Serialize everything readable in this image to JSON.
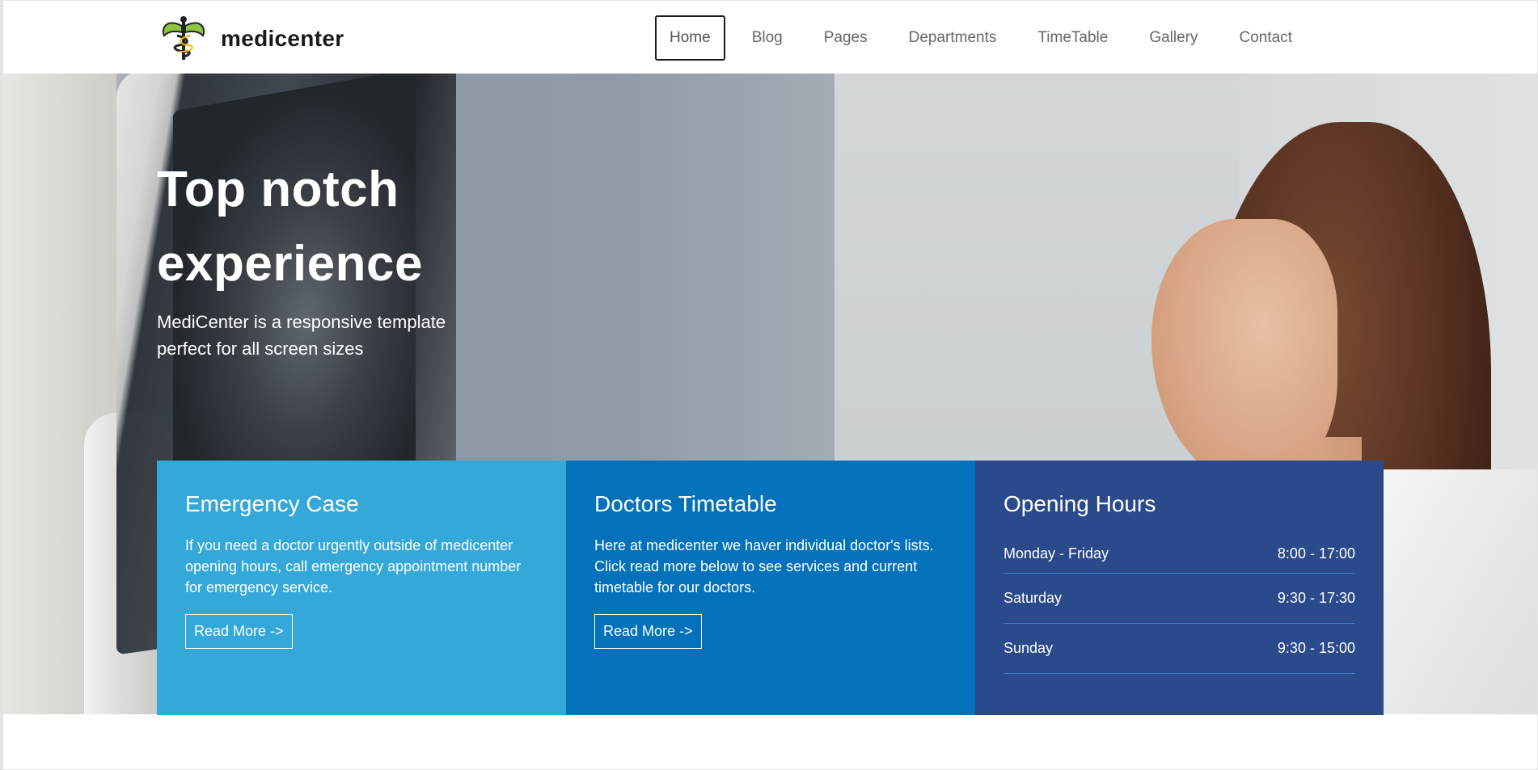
{
  "brand": {
    "name": "medicenter",
    "logo_icon": "caduceus-icon"
  },
  "nav": {
    "items": [
      {
        "label": "Home",
        "active": true
      },
      {
        "label": "Blog"
      },
      {
        "label": "Pages"
      },
      {
        "label": "Departments"
      },
      {
        "label": "TimeTable"
      },
      {
        "label": "Gallery"
      },
      {
        "label": "Contact"
      }
    ]
  },
  "hero": {
    "title_line1": "Top notch",
    "title_line2": "experience",
    "subtitle": "MediCenter is a responsive template perfect for all screen sizes"
  },
  "cards": {
    "emergency": {
      "title": "Emergency Case",
      "text": "If you need a doctor urgently outside of medicenter opening hours, call emergency appointment number for emergency service.",
      "button": "Read More ->"
    },
    "timetable": {
      "title": "Doctors Timetable",
      "text": "Here at medicenter we haver individual doctor's lists. Click read more below to see services and current timetable for our doctors.",
      "button": "Read More ->"
    },
    "hours": {
      "title": "Opening Hours",
      "rows": [
        {
          "day": "Monday - Friday",
          "time": "8:00 - 17:00"
        },
        {
          "day": "Saturday",
          "time": "9:30 - 17:30"
        },
        {
          "day": "Sunday",
          "time": "9:30 - 15:00"
        }
      ]
    }
  },
  "colors": {
    "emergency_bg": "#35a8da",
    "timetable_bg": "#0471bb",
    "hours_bg": "#2a4a8c"
  }
}
